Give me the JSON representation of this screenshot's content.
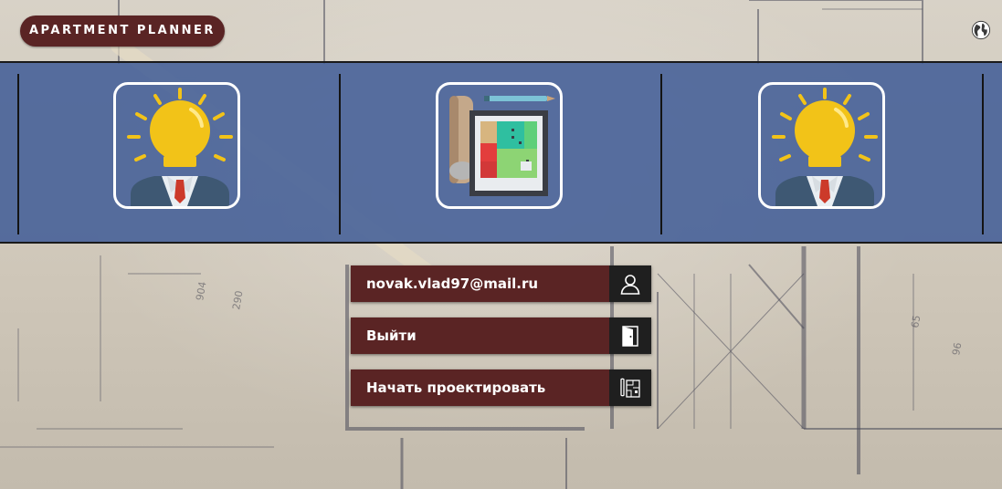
{
  "app": {
    "title": "APARTMENT PLANNER"
  },
  "header": {
    "language_icon": "globe-icon"
  },
  "banner": {
    "tiles": [
      {
        "name": "idea-person",
        "icon": "lightbulb-head-icon"
      },
      {
        "name": "blueprint",
        "icon": "blueprint-plan-icon"
      },
      {
        "name": "idea-person-2",
        "icon": "lightbulb-head-icon"
      }
    ]
  },
  "menu": {
    "account_label": "novak.vlad97@mail.ru",
    "account_icon": "user-icon",
    "logout_label": "Выйти",
    "logout_icon": "door-exit-icon",
    "start_label": "Начать проектировать",
    "start_icon": "floor-plan-icon"
  },
  "colors": {
    "accent": "#5a2424",
    "icon_box": "#1f1f1f",
    "banner": "#405c96"
  }
}
